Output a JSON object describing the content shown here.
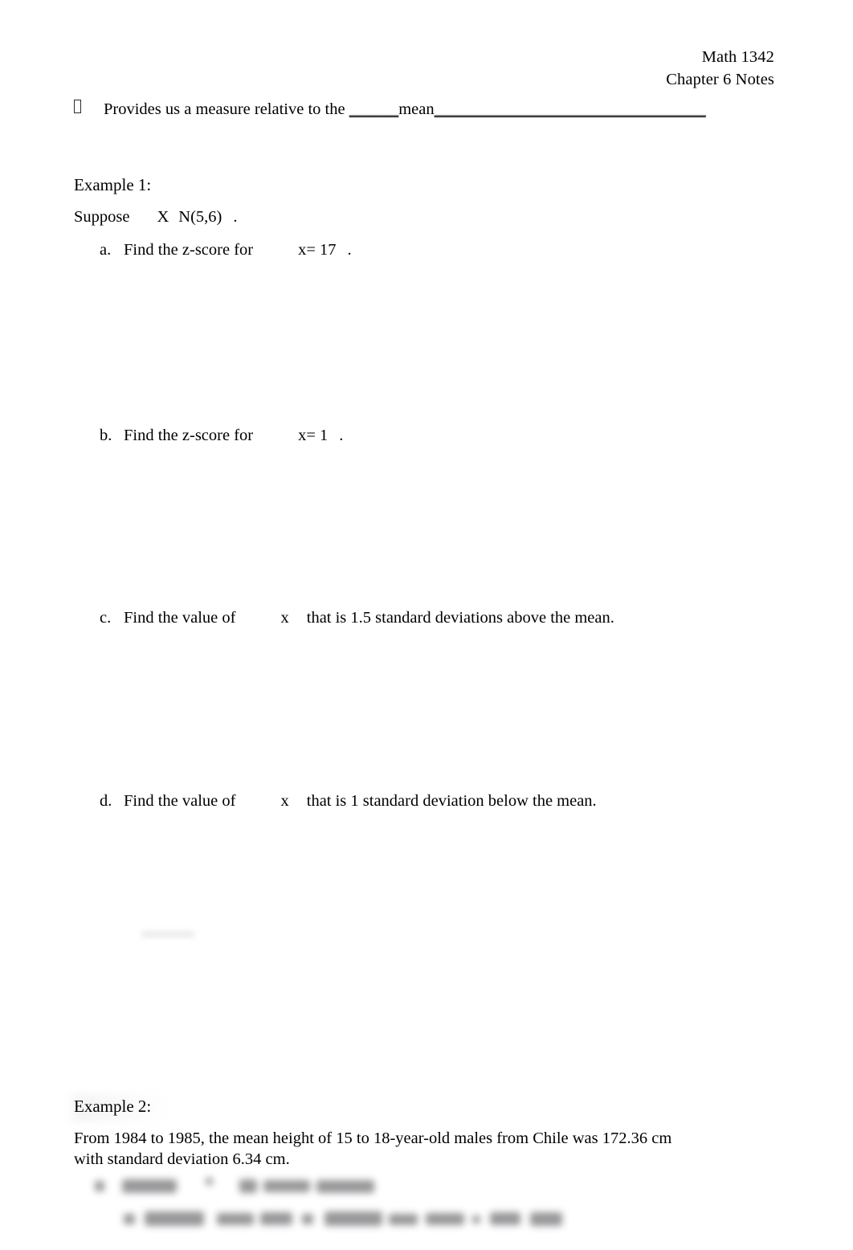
{
  "document": {
    "title": "Math 1342 Chapter 6 Notes",
    "header": {
      "line1": "Math 1342",
      "line2": "Chapter 6 Notes"
    }
  },
  "bullet": {
    "icon": "missing-glyph-box",
    "text_before": "Provides us a measure relative to the ",
    "blank_1": "______",
    "keyword": "mean",
    "blank_2": "_________________________________"
  },
  "example1": {
    "heading": "Example 1:",
    "suppose": {
      "lead": "Suppose",
      "variable": "X",
      "distribution": "N(5,6)",
      "terminator": "."
    },
    "items": [
      {
        "letter": "a.",
        "text": "Find the z-score for",
        "expression": "x= 17",
        "terminator": "."
      },
      {
        "letter": "b.",
        "text": "Find the z-score for",
        "expression": "x= 1",
        "terminator": "."
      },
      {
        "letter": "c.",
        "text": "Find the value of",
        "expression": "x",
        "tail": "that is 1.5 standard deviations above the mean."
      },
      {
        "letter": "d.",
        "text": "Find the value of",
        "expression": "x",
        "tail": "that is 1 standard deviation below the mean."
      }
    ]
  },
  "example2": {
    "heading": "Example 2:",
    "body": "From 1984 to 1985, the mean height of 15 to 18-year-old males from Chile was 172.36 cm with standard deviation 6.34 cm.",
    "obscured_lines": [
      "",
      ""
    ]
  },
  "colors": {
    "page_background": "#ffffff",
    "text": "#000000",
    "blurred_text": "#8e8e90",
    "smudge": "#9a9a9f"
  }
}
